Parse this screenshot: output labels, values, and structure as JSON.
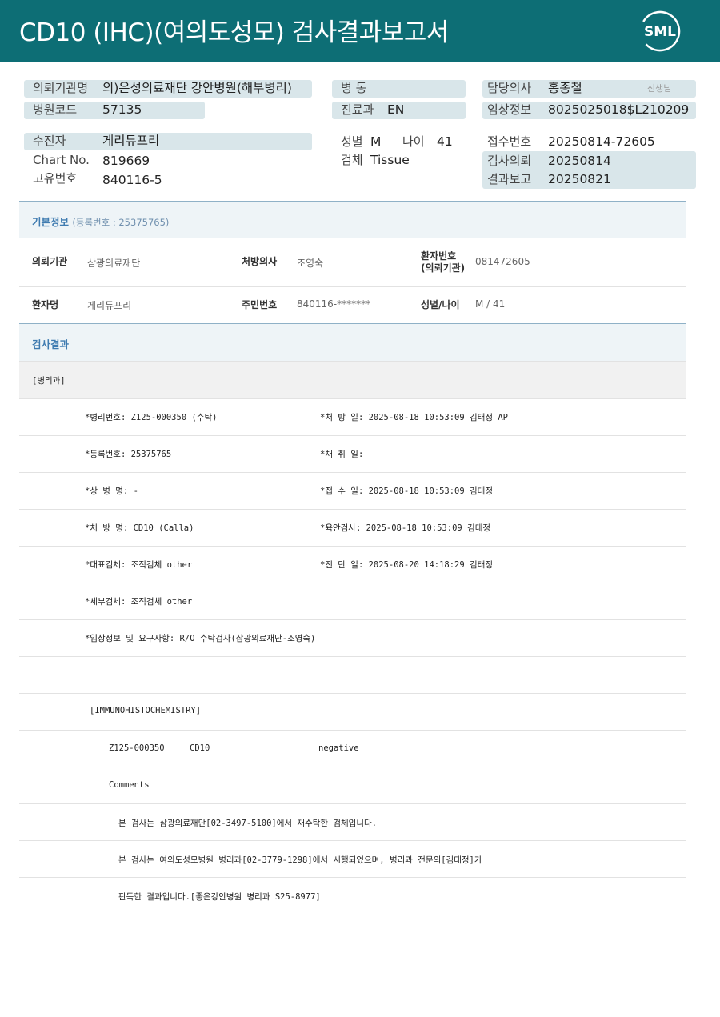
{
  "header": {
    "title": "CD10 (IHC)(여의도성모) 검사결과보고서",
    "logo_text": "SML"
  },
  "info": {
    "referral_label": "의뢰기관명",
    "referral_value": "의)은성의료재단 강안병원(해부병리)",
    "ward_label": "병 동",
    "doctor_label": "담당의사",
    "doctor_value": "홍종철",
    "doctor_suffix": "선생님",
    "hospital_code_label": "병원코드",
    "hospital_code_value": "57135",
    "dept_label": "진료과",
    "dept_value": "EN",
    "clinical_label": "임상정보",
    "clinical_value": "8025025018$L210209",
    "patient_label": "수진자",
    "patient_value": "게리듀프리",
    "sex_label": "성별",
    "sex_value": "M",
    "age_label": "나이",
    "age_value": "41",
    "receipt_label": "접수번호",
    "receipt_value": "20250814-72605",
    "chart_label": "Chart No.",
    "chart_value": "819669",
    "specimen_label": "검체",
    "specimen_value": "Tissue",
    "request_label": "검사의뢰",
    "request_value": "20250814",
    "unique_label": "고유번호",
    "unique_value": "840116-5",
    "report_label": "결과보고",
    "report_value": "20250821"
  },
  "basic": {
    "heading": "기본정보",
    "reg": "(등록번호 : 25375765)",
    "org_label": "의뢰기관",
    "org_value": "삼광의료재단",
    "prescriber_label": "처방의사",
    "prescriber_value": "조영숙",
    "patno_label_1": "환자번호",
    "patno_label_2": "(의뢰기관)",
    "patno_value": "081472605",
    "name_label": "환자명",
    "name_value": "게리듀프리",
    "rrn_label": "주민번호",
    "rrn_value": "840116-*******",
    "sexage_label": "성별/나이",
    "sexage_value": "M / 41"
  },
  "results": {
    "heading": "검사결과",
    "dept": "[병리과]",
    "lines": [
      {
        "left": "*병리번호: Z125-000350 (수탁)",
        "right": "*처 방 일: 2025-08-18 10:53:09  김태정 AP"
      },
      {
        "left": "*등록번호: 25375765",
        "right": "*채 취 일:"
      },
      {
        "left": "*상 병 명: -",
        "right": "*접 수 일: 2025-08-18 10:53:09  김태정"
      },
      {
        "left": "*처 방 명: CD10 (Calla)",
        "right": "*육안검사: 2025-08-18 10:53:09  김태정"
      },
      {
        "left": "*대표검체: 조직검체 other",
        "right": "*진 단 일: 2025-08-20 14:18:29  김태정"
      },
      {
        "left": "*세부검체: 조직검체 other",
        "right": ""
      },
      {
        "left": "*임상정보 및 요구사항: R/O 수탁검사(삼광의료재단-조영숙)",
        "right": ""
      }
    ],
    "ihc_title": "[IMMUNOHISTOCHEMISTRY]",
    "ihc_no": "Z125-000350",
    "ihc_marker": "CD10",
    "ihc_result": "negative",
    "comments_label": "Comments",
    "comment_1": "본 검사는 삼광의료재단[02-3497-5100]에서 재수탁한 검체입니다.",
    "comment_2": "본 검사는 여의도성모병원 병리과[02-3779-1298]에서 시행되었으며, 병리과 전문의[김태정]가",
    "comment_3": "판독한 결과입니다.[좋은강안병원 병리과 S25-8977]"
  },
  "colors": {
    "header_bg": "#0d6e75",
    "pill_bg": "#d9e6ea",
    "section_text": "#3f7bb0"
  }
}
